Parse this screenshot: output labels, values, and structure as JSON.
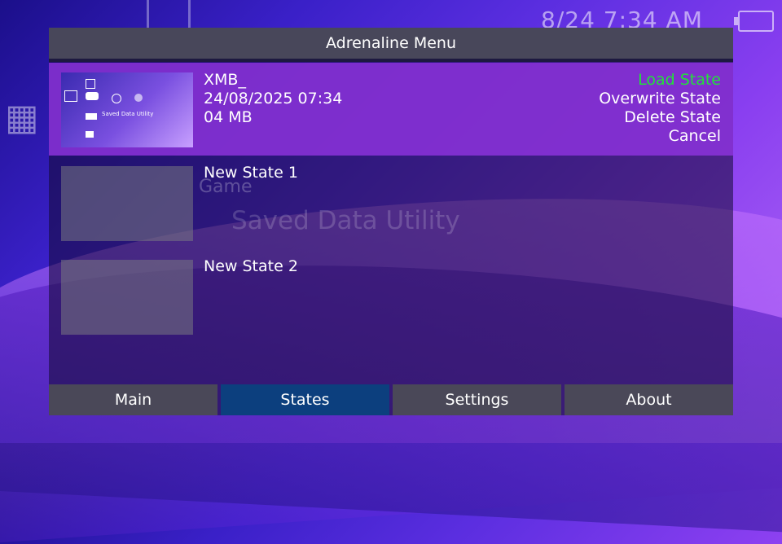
{
  "status": {
    "clock": "8/24 7:34 AM"
  },
  "background": {
    "category_label": "Game",
    "utility_label": "Saved Data Utility"
  },
  "menu": {
    "title": "Adrenaline Menu"
  },
  "states": [
    {
      "name": "XMB_",
      "date": "24/08/2025 07:34",
      "size": "04 MB",
      "thumb_text": "Saved Data Utility"
    },
    {
      "name": "New State 1"
    },
    {
      "name": "New State 2"
    }
  ],
  "actions": [
    "Load State",
    "Overwrite State",
    "Delete State",
    "Cancel"
  ],
  "tabs": [
    "Main",
    "States",
    "Settings",
    "About"
  ],
  "colors": {
    "selected_row": "#8c32dc",
    "active_action": "#22e03a",
    "active_tab": "#0c3f7e",
    "tab": "#4a4858",
    "title_bar": "#48475a"
  }
}
